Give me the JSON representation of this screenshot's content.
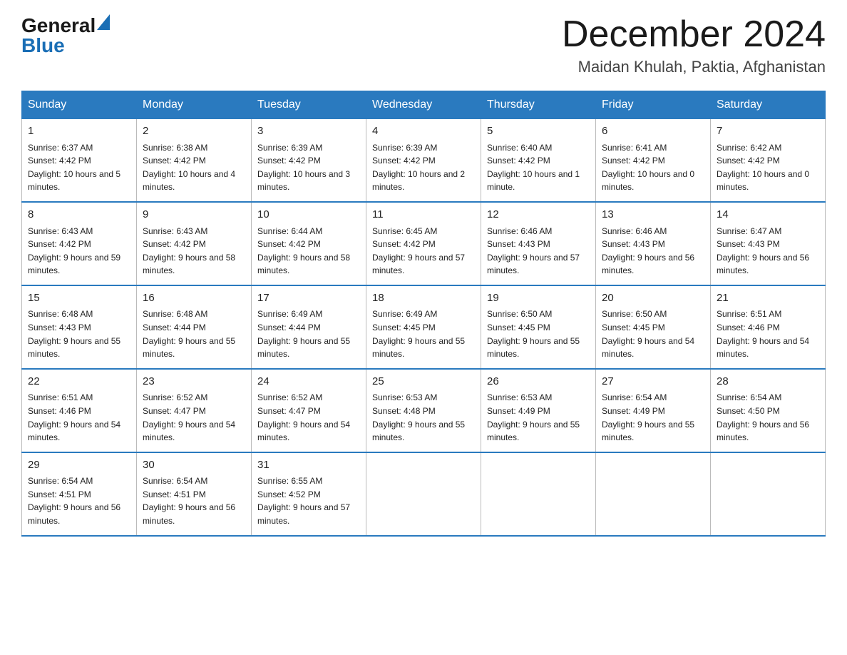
{
  "header": {
    "logo_general": "General",
    "logo_blue": "Blue",
    "month_year": "December 2024",
    "location": "Maidan Khulah, Paktia, Afghanistan"
  },
  "weekdays": [
    "Sunday",
    "Monday",
    "Tuesday",
    "Wednesday",
    "Thursday",
    "Friday",
    "Saturday"
  ],
  "weeks": [
    [
      {
        "day": "1",
        "sunrise": "6:37 AM",
        "sunset": "4:42 PM",
        "daylight": "10 hours and 5 minutes."
      },
      {
        "day": "2",
        "sunrise": "6:38 AM",
        "sunset": "4:42 PM",
        "daylight": "10 hours and 4 minutes."
      },
      {
        "day": "3",
        "sunrise": "6:39 AM",
        "sunset": "4:42 PM",
        "daylight": "10 hours and 3 minutes."
      },
      {
        "day": "4",
        "sunrise": "6:39 AM",
        "sunset": "4:42 PM",
        "daylight": "10 hours and 2 minutes."
      },
      {
        "day": "5",
        "sunrise": "6:40 AM",
        "sunset": "4:42 PM",
        "daylight": "10 hours and 1 minute."
      },
      {
        "day": "6",
        "sunrise": "6:41 AM",
        "sunset": "4:42 PM",
        "daylight": "10 hours and 0 minutes."
      },
      {
        "day": "7",
        "sunrise": "6:42 AM",
        "sunset": "4:42 PM",
        "daylight": "10 hours and 0 minutes."
      }
    ],
    [
      {
        "day": "8",
        "sunrise": "6:43 AM",
        "sunset": "4:42 PM",
        "daylight": "9 hours and 59 minutes."
      },
      {
        "day": "9",
        "sunrise": "6:43 AM",
        "sunset": "4:42 PM",
        "daylight": "9 hours and 58 minutes."
      },
      {
        "day": "10",
        "sunrise": "6:44 AM",
        "sunset": "4:42 PM",
        "daylight": "9 hours and 58 minutes."
      },
      {
        "day": "11",
        "sunrise": "6:45 AM",
        "sunset": "4:42 PM",
        "daylight": "9 hours and 57 minutes."
      },
      {
        "day": "12",
        "sunrise": "6:46 AM",
        "sunset": "4:43 PM",
        "daylight": "9 hours and 57 minutes."
      },
      {
        "day": "13",
        "sunrise": "6:46 AM",
        "sunset": "4:43 PM",
        "daylight": "9 hours and 56 minutes."
      },
      {
        "day": "14",
        "sunrise": "6:47 AM",
        "sunset": "4:43 PM",
        "daylight": "9 hours and 56 minutes."
      }
    ],
    [
      {
        "day": "15",
        "sunrise": "6:48 AM",
        "sunset": "4:43 PM",
        "daylight": "9 hours and 55 minutes."
      },
      {
        "day": "16",
        "sunrise": "6:48 AM",
        "sunset": "4:44 PM",
        "daylight": "9 hours and 55 minutes."
      },
      {
        "day": "17",
        "sunrise": "6:49 AM",
        "sunset": "4:44 PM",
        "daylight": "9 hours and 55 minutes."
      },
      {
        "day": "18",
        "sunrise": "6:49 AM",
        "sunset": "4:45 PM",
        "daylight": "9 hours and 55 minutes."
      },
      {
        "day": "19",
        "sunrise": "6:50 AM",
        "sunset": "4:45 PM",
        "daylight": "9 hours and 55 minutes."
      },
      {
        "day": "20",
        "sunrise": "6:50 AM",
        "sunset": "4:45 PM",
        "daylight": "9 hours and 54 minutes."
      },
      {
        "day": "21",
        "sunrise": "6:51 AM",
        "sunset": "4:46 PM",
        "daylight": "9 hours and 54 minutes."
      }
    ],
    [
      {
        "day": "22",
        "sunrise": "6:51 AM",
        "sunset": "4:46 PM",
        "daylight": "9 hours and 54 minutes."
      },
      {
        "day": "23",
        "sunrise": "6:52 AM",
        "sunset": "4:47 PM",
        "daylight": "9 hours and 54 minutes."
      },
      {
        "day": "24",
        "sunrise": "6:52 AM",
        "sunset": "4:47 PM",
        "daylight": "9 hours and 54 minutes."
      },
      {
        "day": "25",
        "sunrise": "6:53 AM",
        "sunset": "4:48 PM",
        "daylight": "9 hours and 55 minutes."
      },
      {
        "day": "26",
        "sunrise": "6:53 AM",
        "sunset": "4:49 PM",
        "daylight": "9 hours and 55 minutes."
      },
      {
        "day": "27",
        "sunrise": "6:54 AM",
        "sunset": "4:49 PM",
        "daylight": "9 hours and 55 minutes."
      },
      {
        "day": "28",
        "sunrise": "6:54 AM",
        "sunset": "4:50 PM",
        "daylight": "9 hours and 56 minutes."
      }
    ],
    [
      {
        "day": "29",
        "sunrise": "6:54 AM",
        "sunset": "4:51 PM",
        "daylight": "9 hours and 56 minutes."
      },
      {
        "day": "30",
        "sunrise": "6:54 AM",
        "sunset": "4:51 PM",
        "daylight": "9 hours and 56 minutes."
      },
      {
        "day": "31",
        "sunrise": "6:55 AM",
        "sunset": "4:52 PM",
        "daylight": "9 hours and 57 minutes."
      },
      null,
      null,
      null,
      null
    ]
  ]
}
